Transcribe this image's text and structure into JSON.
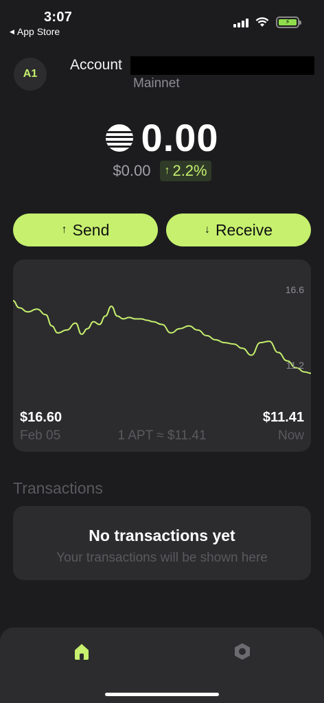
{
  "status_bar": {
    "time": "3:07",
    "back_label": "App Store"
  },
  "account": {
    "avatar_initials": "A1",
    "label": "Account",
    "network": "Mainnet"
  },
  "balance": {
    "amount": "0.00",
    "fiat": "$0.00",
    "change": "2.2%",
    "change_color": "#c6f06e"
  },
  "actions": {
    "send_label": "Send",
    "receive_label": "Receive"
  },
  "chart_data": {
    "type": "line",
    "y_ticks": [
      "16.6",
      "11.2"
    ],
    "start_price": "$16.60",
    "end_price": "$11.41",
    "start_date": "Feb 05",
    "end_date": "Now",
    "rate_text": "1 APT ≈ $11.41",
    "x": [
      0,
      0.02,
      0.05,
      0.08,
      0.11,
      0.13,
      0.15,
      0.18,
      0.21,
      0.23,
      0.25,
      0.27,
      0.29,
      0.31,
      0.33,
      0.35,
      0.37,
      0.39,
      0.41,
      0.43,
      0.45,
      0.47,
      0.5,
      0.53,
      0.56,
      0.59,
      0.62,
      0.65,
      0.68,
      0.71,
      0.74,
      0.77,
      0.8,
      0.83,
      0.86,
      0.89,
      0.92,
      0.95,
      0.98,
      1.0
    ],
    "y": [
      16.6,
      16.1,
      15.8,
      16.0,
      15.6,
      14.8,
      14.3,
      14.5,
      15.0,
      14.2,
      14.6,
      15.1,
      14.9,
      15.5,
      16.2,
      15.5,
      15.3,
      15.4,
      15.3,
      15.3,
      15.2,
      15.1,
      14.9,
      14.3,
      14.6,
      14.8,
      14.5,
      14.1,
      13.8,
      13.6,
      13.5,
      13.2,
      12.7,
      13.6,
      13.7,
      12.9,
      12.3,
      11.8,
      11.5,
      11.41
    ],
    "ylim": [
      11.2,
      16.6
    ],
    "line_color": "#c6f06e"
  },
  "transactions": {
    "heading": "Transactions",
    "empty_title": "No transactions yet",
    "empty_subtitle": "Your transactions will be shown here"
  },
  "tab_bar": {
    "items": [
      {
        "icon": "home-icon",
        "active": true
      },
      {
        "icon": "settings-icon",
        "active": false
      }
    ]
  }
}
